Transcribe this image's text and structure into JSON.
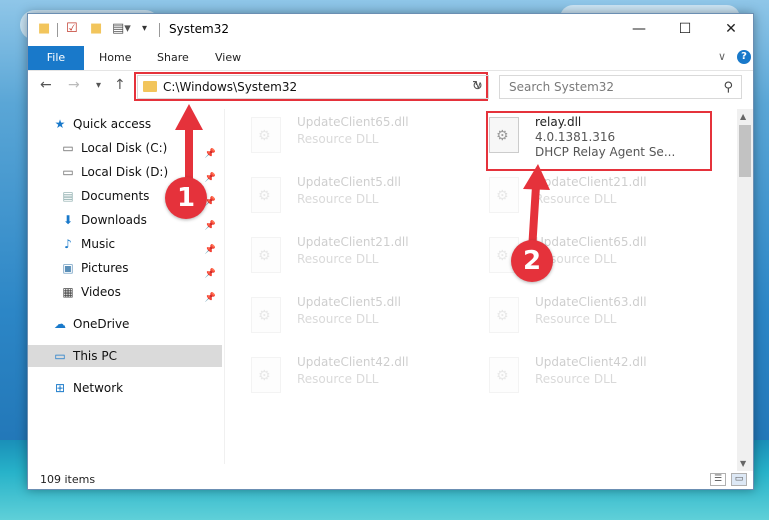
{
  "window": {
    "title": "System32"
  },
  "ribbon": {
    "tabs": [
      "File",
      "Home",
      "Share",
      "View"
    ]
  },
  "address": {
    "path": "C:\\Windows\\System32"
  },
  "search": {
    "placeholder": "Search System32"
  },
  "sidebar": {
    "quick_access": "Quick access",
    "items": [
      {
        "label": "Local Disk (C:)",
        "icon": "drive-icon"
      },
      {
        "label": "Local Disk (D:)",
        "icon": "drive-icon"
      },
      {
        "label": "Documents",
        "icon": "documents-icon"
      },
      {
        "label": "Downloads",
        "icon": "downloads-icon"
      },
      {
        "label": "Music",
        "icon": "music-icon"
      },
      {
        "label": "Pictures",
        "icon": "pictures-icon"
      },
      {
        "label": "Videos",
        "icon": "videos-icon"
      }
    ],
    "onedrive": "OneDrive",
    "this_pc": "This PC",
    "network": "Network"
  },
  "files": [
    {
      "name": "UpdateClient65.dll",
      "desc": "Resource DLL"
    },
    {
      "name": "relay.dll",
      "version": "4.0.1381.316",
      "desc": "DHCP Relay Agent Se..."
    },
    {
      "name": "UpdateClient5.dll",
      "desc": "Resource DLL"
    },
    {
      "name": "UpdateClient21.dll",
      "desc": "Resource DLL"
    },
    {
      "name": "UpdateClient21.dll",
      "desc": "Resource DLL"
    },
    {
      "name": "UpdateClient65.dll",
      "desc": "Resource DLL"
    },
    {
      "name": "UpdateClient5.dll",
      "desc": "Resource DLL"
    },
    {
      "name": "UpdateClient63.dll",
      "desc": "Resource DLL"
    },
    {
      "name": "UpdateClient42.dll",
      "desc": "Resource DLL"
    },
    {
      "name": "UpdateClient42.dll",
      "desc": "Resource DLL"
    }
  ],
  "status": {
    "items_count": "109 items"
  },
  "markers": {
    "first": "1",
    "second": "2"
  },
  "colors": {
    "accent": "#1979ca",
    "highlight": "#e5323b"
  }
}
